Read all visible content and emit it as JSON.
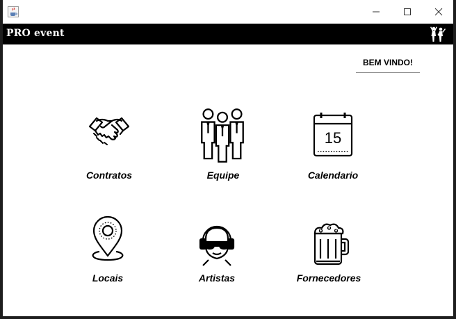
{
  "window": {
    "app_icon": "java-cup-icon",
    "controls": [
      "minimize-icon",
      "maximize-icon",
      "close-icon"
    ]
  },
  "header": {
    "brand": "PRO event",
    "brand_icon": "party-people-icon"
  },
  "welcome": "BEM VINDO!",
  "tiles": [
    {
      "label": "Contratos",
      "icon": "handshake-icon"
    },
    {
      "label": "Equipe",
      "icon": "team-icon"
    },
    {
      "label": "Calendario",
      "icon": "calendar-icon",
      "calendar_day": "15"
    },
    {
      "label": "Locais",
      "icon": "location-pin-icon"
    },
    {
      "label": "Artistas",
      "icon": "dj-headphones-icon"
    },
    {
      "label": "Fornecedores",
      "icon": "beer-mug-icon"
    }
  ]
}
